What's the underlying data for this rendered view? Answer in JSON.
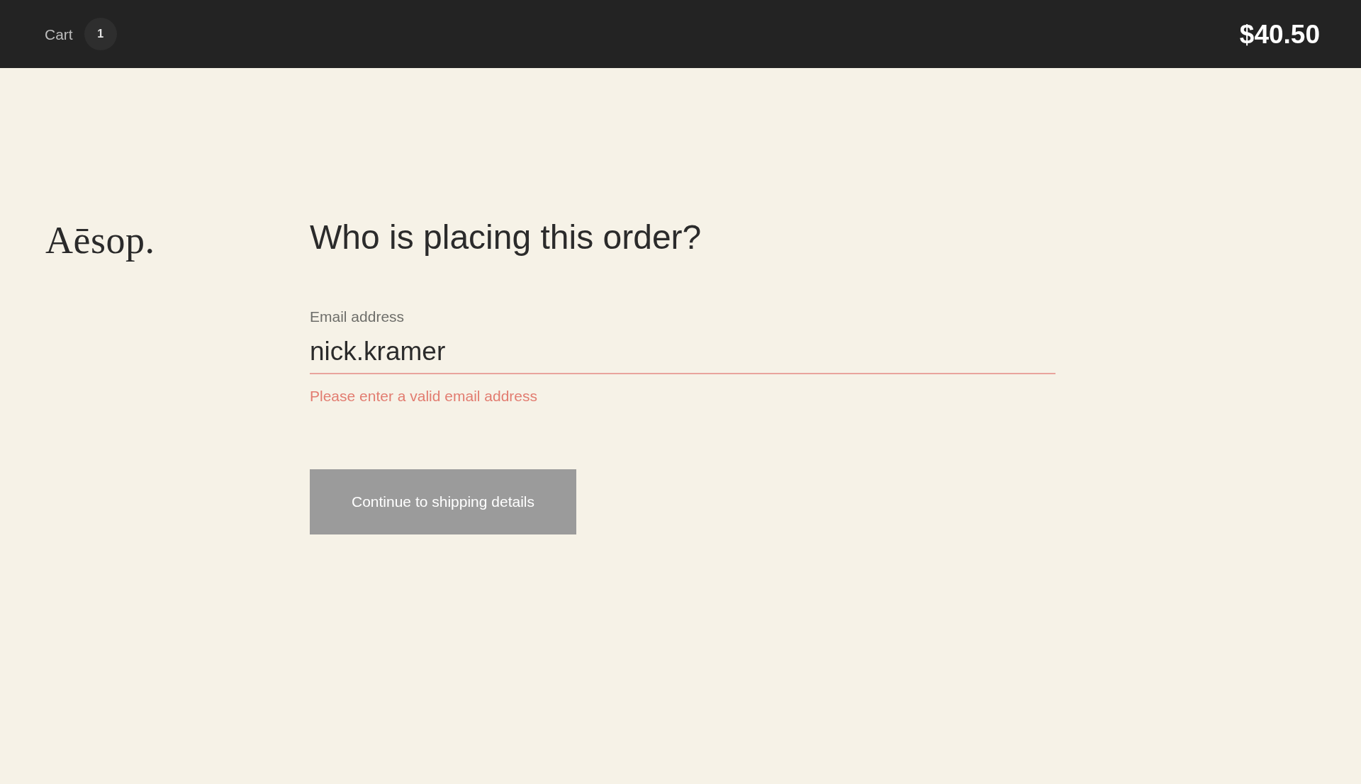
{
  "top_bar": {
    "cart_label": "Cart",
    "cart_count": "1",
    "total": "$40.50"
  },
  "logo": "Aēsop.",
  "form": {
    "heading": "Who is placing this order?",
    "email_field": {
      "label": "Email address",
      "value": "nick.kramer",
      "error": "Please enter a valid email address"
    },
    "continue_button": {
      "label": "Continue to shipping details",
      "disabled": true
    }
  }
}
